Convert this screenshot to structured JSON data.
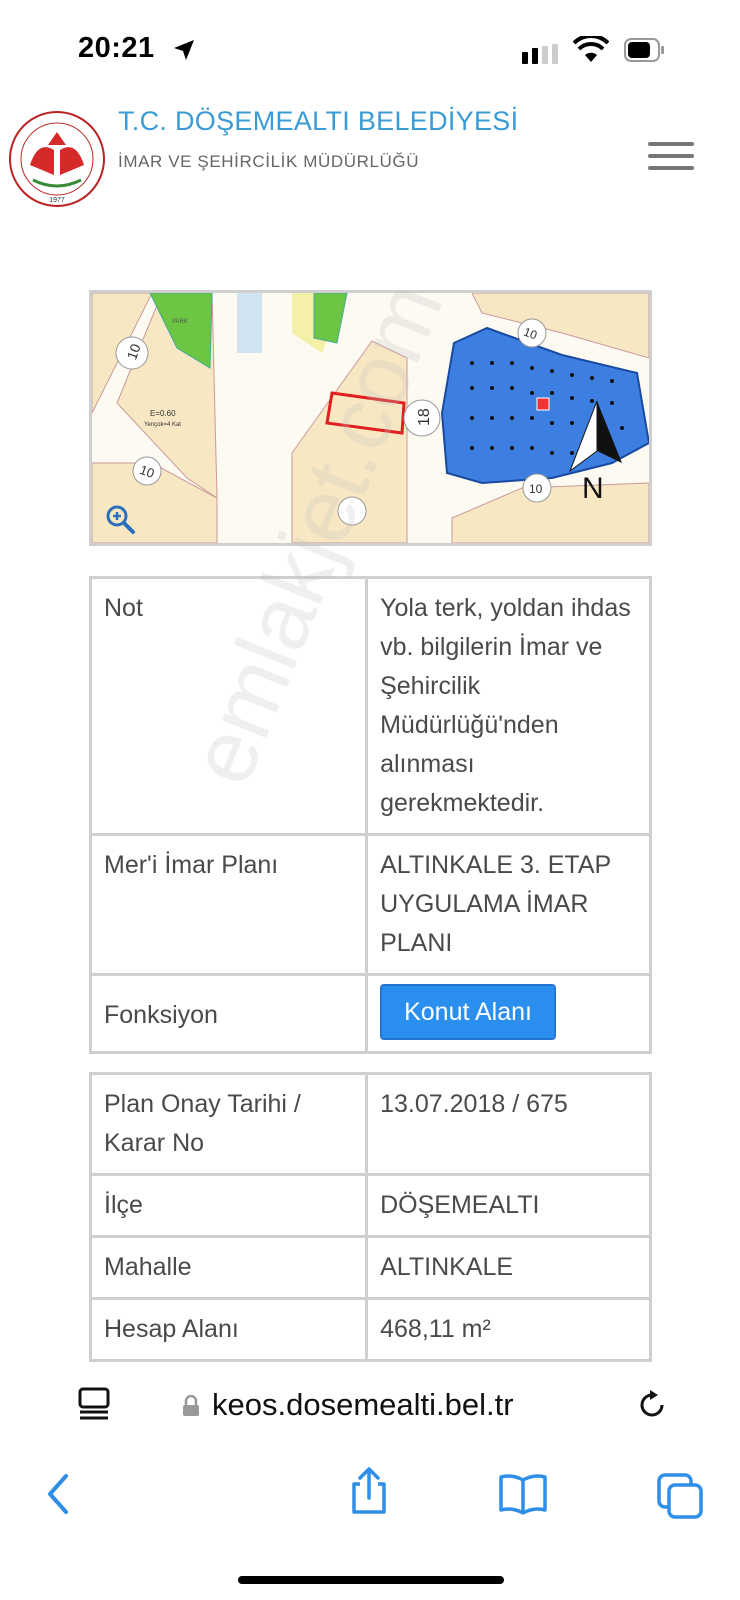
{
  "status_bar": {
    "time": "20:21"
  },
  "header": {
    "title": "T.C. DÖŞEMEALTI BELEDİYESİ",
    "subtitle": "İMAR VE ŞEHİRCİLİK MÜDÜRLÜĞÜ",
    "logo_text": "DÖŞEMEALTI BELEDİYESİ",
    "logo_year": "1977"
  },
  "map": {
    "labels": {
      "park": "PARK",
      "zoning": "E=0.60",
      "zoning2": "Yençok=4 Kat",
      "road_10a": "10",
      "road_10b": "10",
      "road_18": "18",
      "road_10c": "10",
      "road_10d": "10",
      "north": "N"
    }
  },
  "table1": {
    "rows": [
      {
        "label": "Not",
        "value": "Yola terk, yoldan ihdas vb. bilgilerin İmar ve Şehircilik Müdürlüğü'nden alınması gerekmektedir."
      },
      {
        "label": "Mer'i İmar Planı",
        "value": "ALTINKALE 3. ETAP UYGULAMA İMAR PLANI"
      },
      {
        "label": "Fonksiyon",
        "button": "Konut Alanı"
      }
    ]
  },
  "table2": {
    "rows": [
      {
        "label": "Plan Onay Tarihi / Karar No",
        "value": "13.07.2018 / 675"
      },
      {
        "label": "İlçe",
        "value": "DÖŞEMEALTI"
      },
      {
        "label": "Mahalle",
        "value": "ALTINKALE"
      },
      {
        "label": "Hesap Alanı",
        "value": "468,11 m²"
      }
    ]
  },
  "browser": {
    "url": "keos.dosemealti.bel.tr"
  },
  "watermark": "emlakjet.com",
  "colors": {
    "accent": "#3a9bd5",
    "button": "#2b8ff0",
    "map_blue": "#3d7fe0",
    "map_green": "#6cc644",
    "map_parcel": "#f7e7c3"
  }
}
